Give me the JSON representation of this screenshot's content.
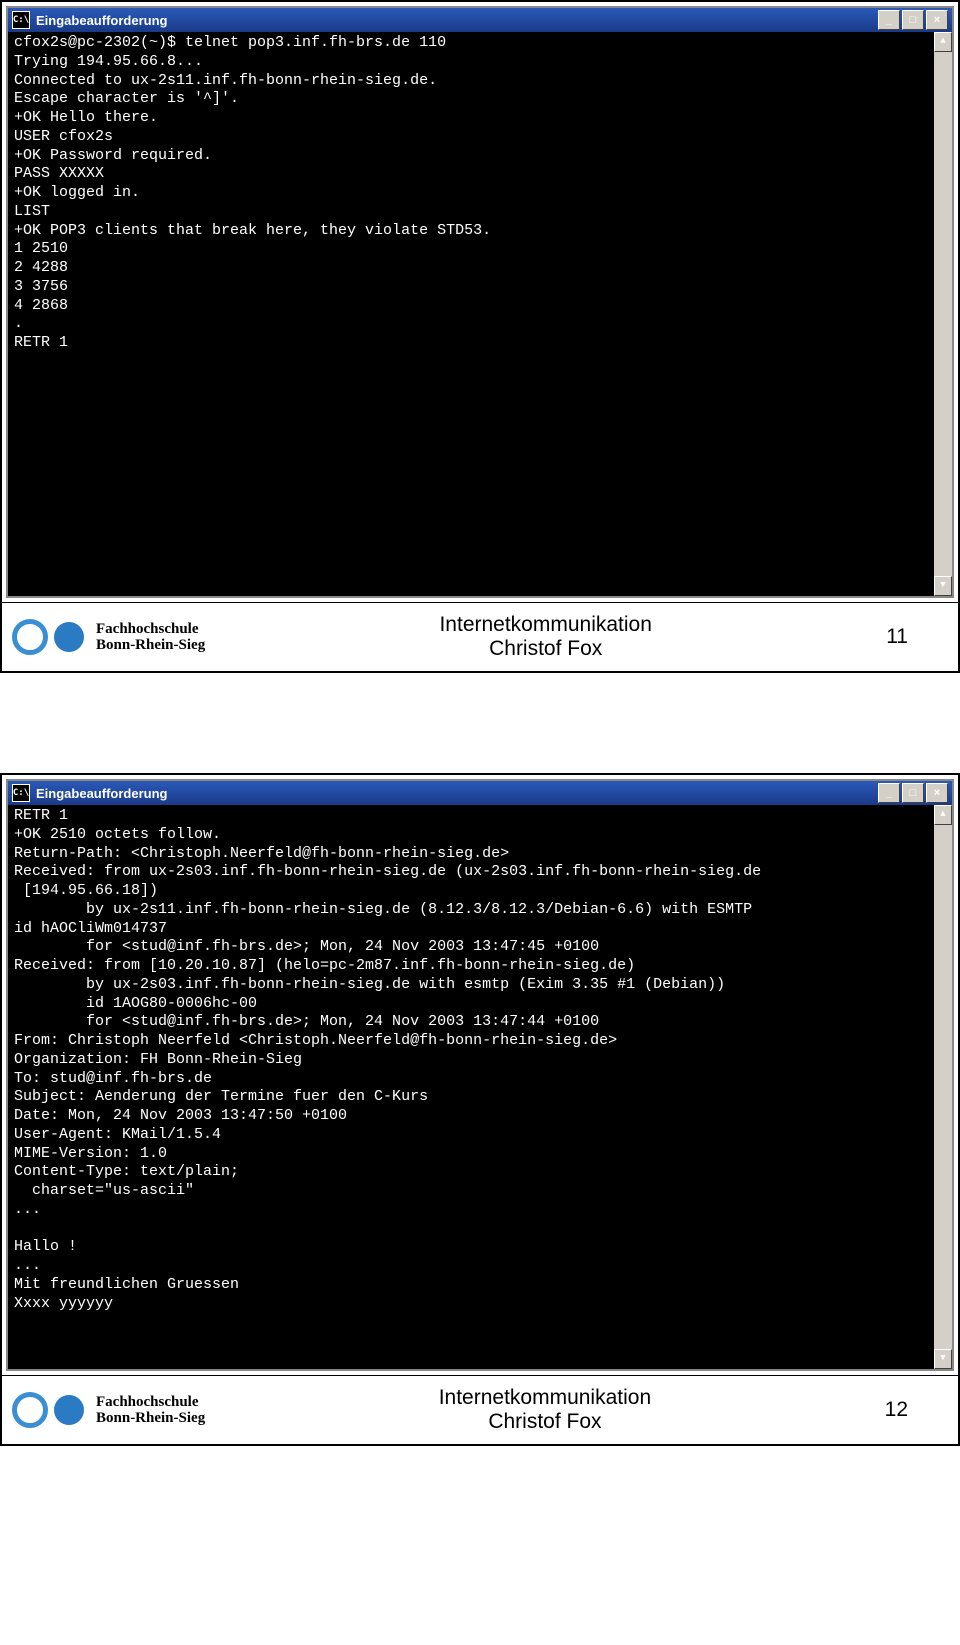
{
  "windowTitle": "Eingabeaufforderung",
  "slide1": {
    "terminal": "cfox2s@pc-2302(~)$ telnet pop3.inf.fh-brs.de 110\nTrying 194.95.66.8...\nConnected to ux-2s11.inf.fh-bonn-rhein-sieg.de.\nEscape character is '^]'.\n+OK Hello there.\nUSER cfox2s\n+OK Password required.\nPASS XXXXX\n+OK logged in.\nLIST\n+OK POP3 clients that break here, they violate STD53.\n1 2510\n2 4288\n3 3756\n4 2868\n.\nRETR 1",
    "page": "11"
  },
  "slide2": {
    "terminal": "RETR 1\n+OK 2510 octets follow.\nReturn-Path: <Christoph.Neerfeld@fh-bonn-rhein-sieg.de>\nReceived: from ux-2s03.inf.fh-bonn-rhein-sieg.de (ux-2s03.inf.fh-bonn-rhein-sieg.de\n [194.95.66.18])\n        by ux-2s11.inf.fh-bonn-rhein-sieg.de (8.12.3/8.12.3/Debian-6.6) with ESMTP\nid hAOCliWm014737\n        for <stud@inf.fh-brs.de>; Mon, 24 Nov 2003 13:47:45 +0100\nReceived: from [10.20.10.87] (helo=pc-2m87.inf.fh-bonn-rhein-sieg.de)\n        by ux-2s03.inf.fh-bonn-rhein-sieg.de with esmtp (Exim 3.35 #1 (Debian))\n        id 1AOG80-0006hc-00\n        for <stud@inf.fh-brs.de>; Mon, 24 Nov 2003 13:47:44 +0100\nFrom: Christoph Neerfeld <Christoph.Neerfeld@fh-bonn-rhein-sieg.de>\nOrganization: FH Bonn-Rhein-Sieg\nTo: stud@inf.fh-brs.de\nSubject: Aenderung der Termine fuer den C-Kurs\nDate: Mon, 24 Nov 2003 13:47:50 +0100\nUser-Agent: KMail/1.5.4\nMIME-Version: 1.0\nContent-Type: text/plain;\n  charset=\"us-ascii\"\n...\n\nHallo !\n...\nMit freundlichen Gruessen\nXxxx yyyyyy",
    "page": "12"
  },
  "footer": {
    "uni1": "Fachhochschule",
    "uni2": "Bonn-Rhein-Sieg",
    "title": "Internetkommunikation",
    "author": "Christof Fox"
  },
  "iconText": "C:\\",
  "buttons": {
    "min": "_",
    "max": "□",
    "close": "×"
  }
}
